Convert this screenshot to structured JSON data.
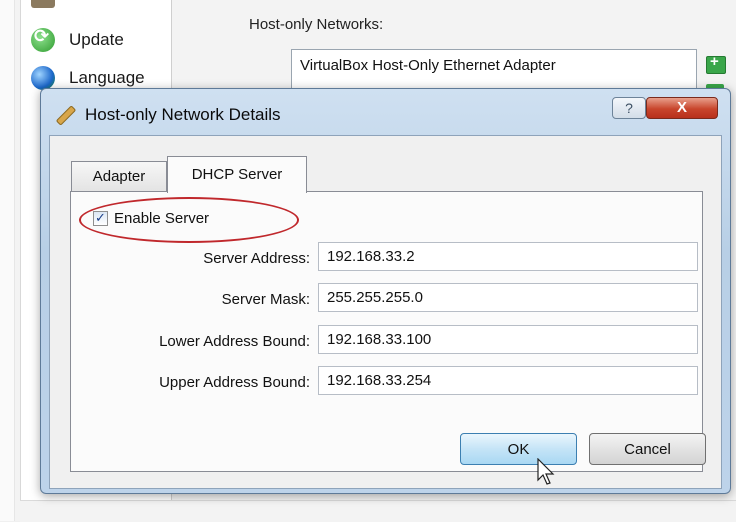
{
  "settings_window": {
    "sidebar": {
      "items": [
        {
          "label": "",
          "icon": "network-icon"
        },
        {
          "label": "Update",
          "icon": "update-icon"
        },
        {
          "label": "Language",
          "icon": "globe-icon"
        }
      ]
    },
    "main": {
      "section_title": "Host-only Networks:",
      "networks": [
        "VirtualBox Host-Only Ethernet Adapter"
      ]
    }
  },
  "dialog": {
    "title": "Host-only Network Details",
    "help_glyph": "?",
    "close_glyph": "X",
    "tabs": [
      {
        "label": "Adapter",
        "active": false
      },
      {
        "label": "DHCP Server",
        "active": true
      }
    ],
    "dhcp": {
      "enable_server_label": "Enable Server",
      "enable_server_checked": true,
      "checkmark": "✓",
      "fields": [
        {
          "label": "Server Address:",
          "value": "192.168.33.2"
        },
        {
          "label": "Server Mask:",
          "value": "255.255.255.0"
        },
        {
          "label": "Lower Address Bound:",
          "value": "192.168.33.100"
        },
        {
          "label": "Upper Address Bound:",
          "value": "192.168.33.254"
        }
      ]
    },
    "buttons": {
      "ok": "OK",
      "cancel": "Cancel"
    }
  },
  "colors": {
    "highlight": "#c0282c",
    "ok_button_border": "#3c7fb1",
    "close_button": "#c8452c"
  }
}
